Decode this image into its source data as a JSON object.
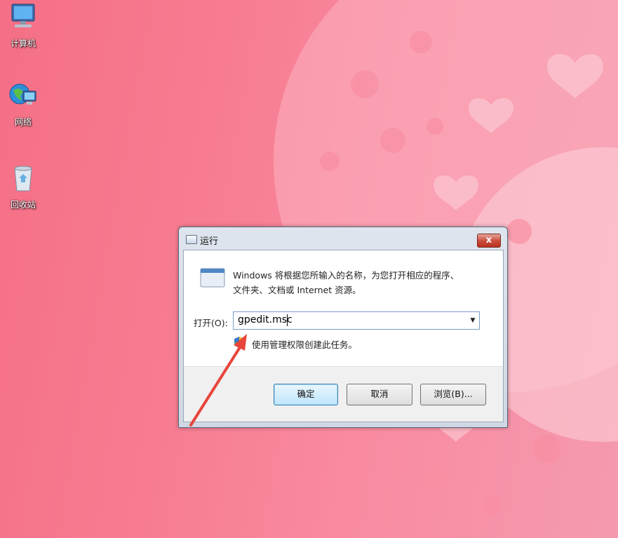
{
  "desktop": {
    "icons": [
      {
        "label": "计算机",
        "icon": "computer-icon"
      },
      {
        "label": "网络",
        "icon": "network-icon"
      },
      {
        "label": "回收站",
        "icon": "recycle-bin-icon"
      }
    ]
  },
  "dialog": {
    "title": "运行",
    "close_label": "x",
    "description_line1": "Windows 将根据您所输入的名称，为您打开相应的程序、",
    "description_line2": "文件夹、文档或 Internet 资源。",
    "open_label": "打开(O):",
    "command_value": "gpedit.msc",
    "admin_note": "使用管理权限创建此任务。",
    "buttons": {
      "ok": "确定",
      "cancel": "取消",
      "browse": "浏览(B)..."
    }
  },
  "colors": {
    "background": "#f77d92",
    "annotation_arrow": "#e8453c"
  }
}
